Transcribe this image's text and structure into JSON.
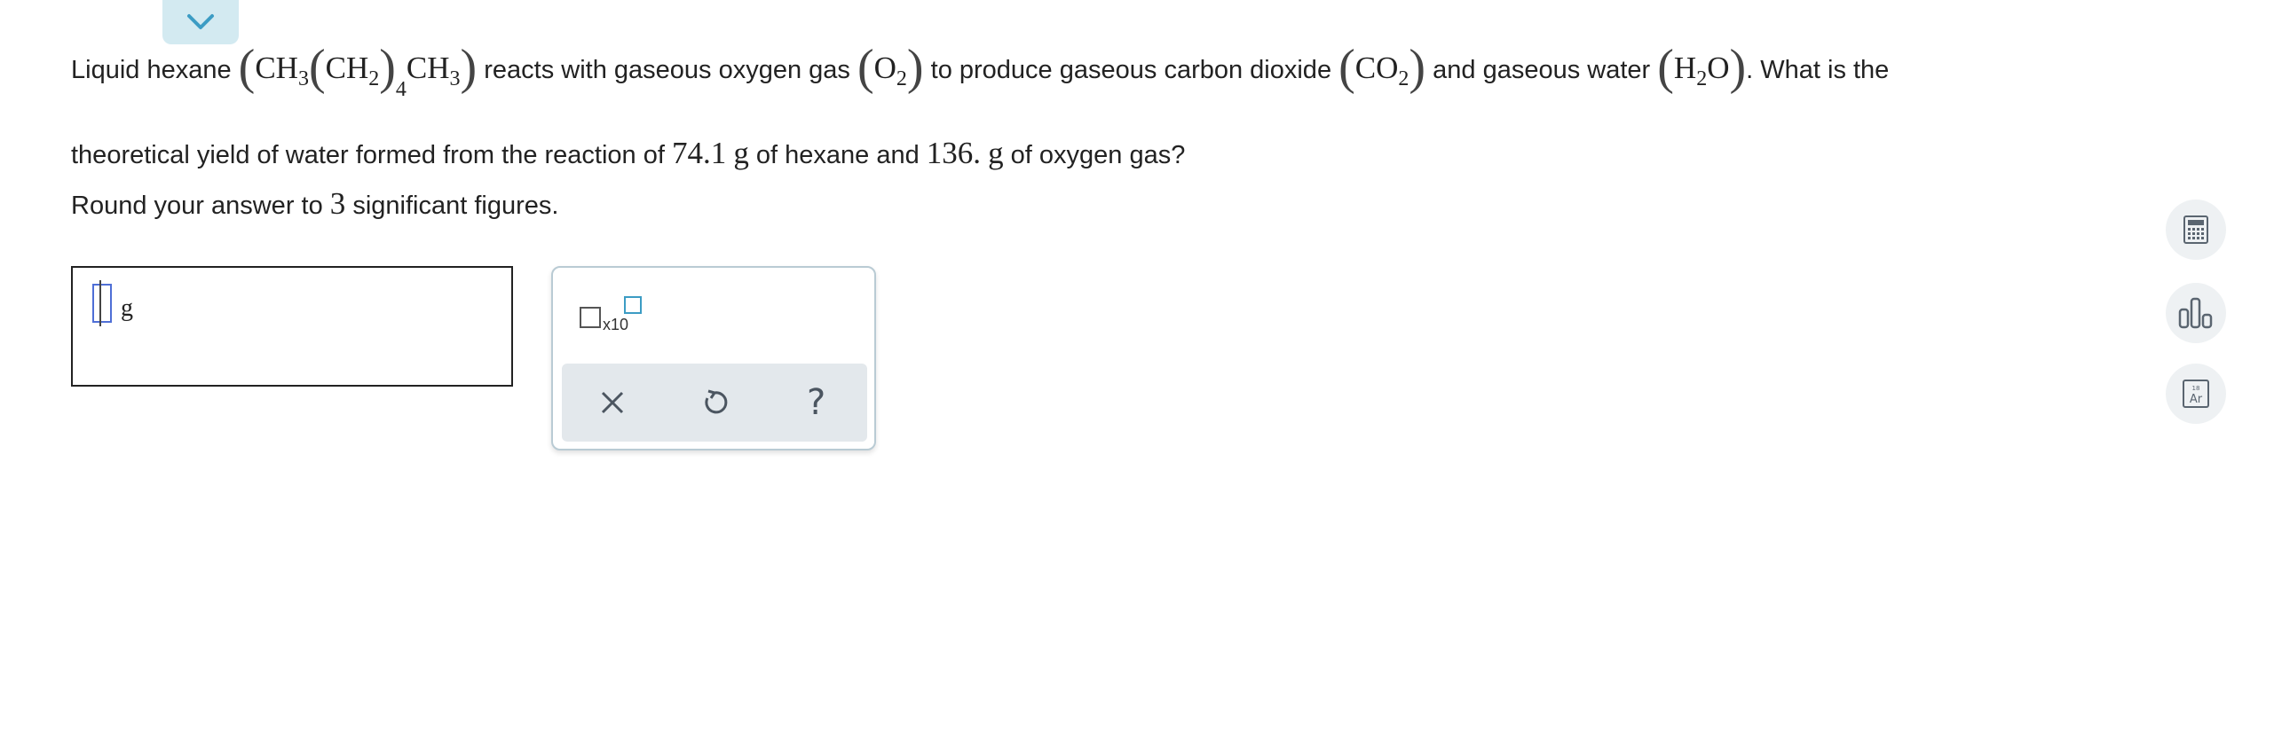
{
  "question": {
    "intro": "Liquid hexane",
    "hexane_formula": {
      "a": "CH",
      "a_sub": "3",
      "b": "CH",
      "b_sub": "2",
      "group_sub": "4",
      "c": "CH",
      "c_sub": "3"
    },
    "t_reacts": "reacts with gaseous oxygen gas",
    "oxygen_formula": {
      "a": "O",
      "a_sub": "2"
    },
    "t_produce": "to produce gaseous carbon dioxide",
    "co2_formula": {
      "a": "CO",
      "a_sub": "2"
    },
    "t_water": "and gaseous water",
    "water_formula": {
      "a": "H",
      "a_sub": "2",
      "b": "O"
    },
    "t_ask": ". What is the",
    "line2_a": "theoretical yield of water formed from the reaction of",
    "hexane_mass": "74.1",
    "unit_g": "g",
    "line2_b": "of hexane and",
    "oxygen_mass": "136.",
    "line2_c": "of oxygen gas?"
  },
  "rounding": {
    "a": "Round your answer to",
    "sig": "3",
    "b": "significant figures."
  },
  "answer": {
    "value": "",
    "unit": "g"
  },
  "palette": {
    "x10_label": "x10",
    "help_label": "?"
  },
  "colors": {
    "accent": "#3c9cc4",
    "tab_bg": "#d3eaf1",
    "palette_bg": "#e3e8ec"
  },
  "icons": [
    "chevron-down-icon",
    "close-icon",
    "undo-icon",
    "calculator-icon",
    "bar-chart-icon",
    "periodic-table-icon"
  ]
}
